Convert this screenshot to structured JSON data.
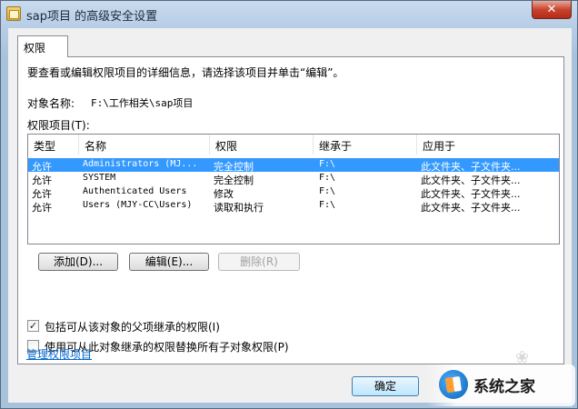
{
  "window": {
    "title": "sap项目 的高级安全设置",
    "close_glyph": "✕"
  },
  "tab": {
    "label": "权限"
  },
  "panel": {
    "description": "要查看或编辑权限项目的详细信息，请选择该项目并单击“编辑”。",
    "object_name_label": "对象名称:",
    "object_name_value": "F:\\工作相关\\sap项目",
    "entries_label": "权限项目(T):"
  },
  "table": {
    "columns": [
      "类型",
      "名称",
      "权限",
      "继承于",
      "应用于"
    ],
    "rows": [
      {
        "type": "允许",
        "name": "Administrators (MJ...",
        "permission": "完全控制",
        "inherited_from": "F:\\",
        "applies_to": "此文件夹、子文件夹..."
      },
      {
        "type": "允许",
        "name": "SYSTEM",
        "permission": "完全控制",
        "inherited_from": "F:\\",
        "applies_to": "此文件夹、子文件夹..."
      },
      {
        "type": "允许",
        "name": "Authenticated Users",
        "permission": "修改",
        "inherited_from": "F:\\",
        "applies_to": "此文件夹、子文件夹..."
      },
      {
        "type": "允许",
        "name": "Users (MJY-CC\\Users)",
        "permission": "读取和执行",
        "inherited_from": "F:\\",
        "applies_to": "此文件夹、子文件夹..."
      }
    ],
    "selected_row": 0
  },
  "buttons": {
    "add": "添加(D)...",
    "edit": "编辑(E)...",
    "remove": "删除(R)",
    "ok": "确定"
  },
  "checkboxes": {
    "inherit": {
      "label": "包括可从该对象的父项继承的权限(I)",
      "checked": true,
      "mark": "✓"
    },
    "replace": {
      "label": "使用可从此对象继承的权限替换所有子对象权限(P)",
      "checked": false,
      "mark": ""
    }
  },
  "links": {
    "manage": "管理权限项目"
  },
  "watermark": {
    "text": "系统之家"
  }
}
